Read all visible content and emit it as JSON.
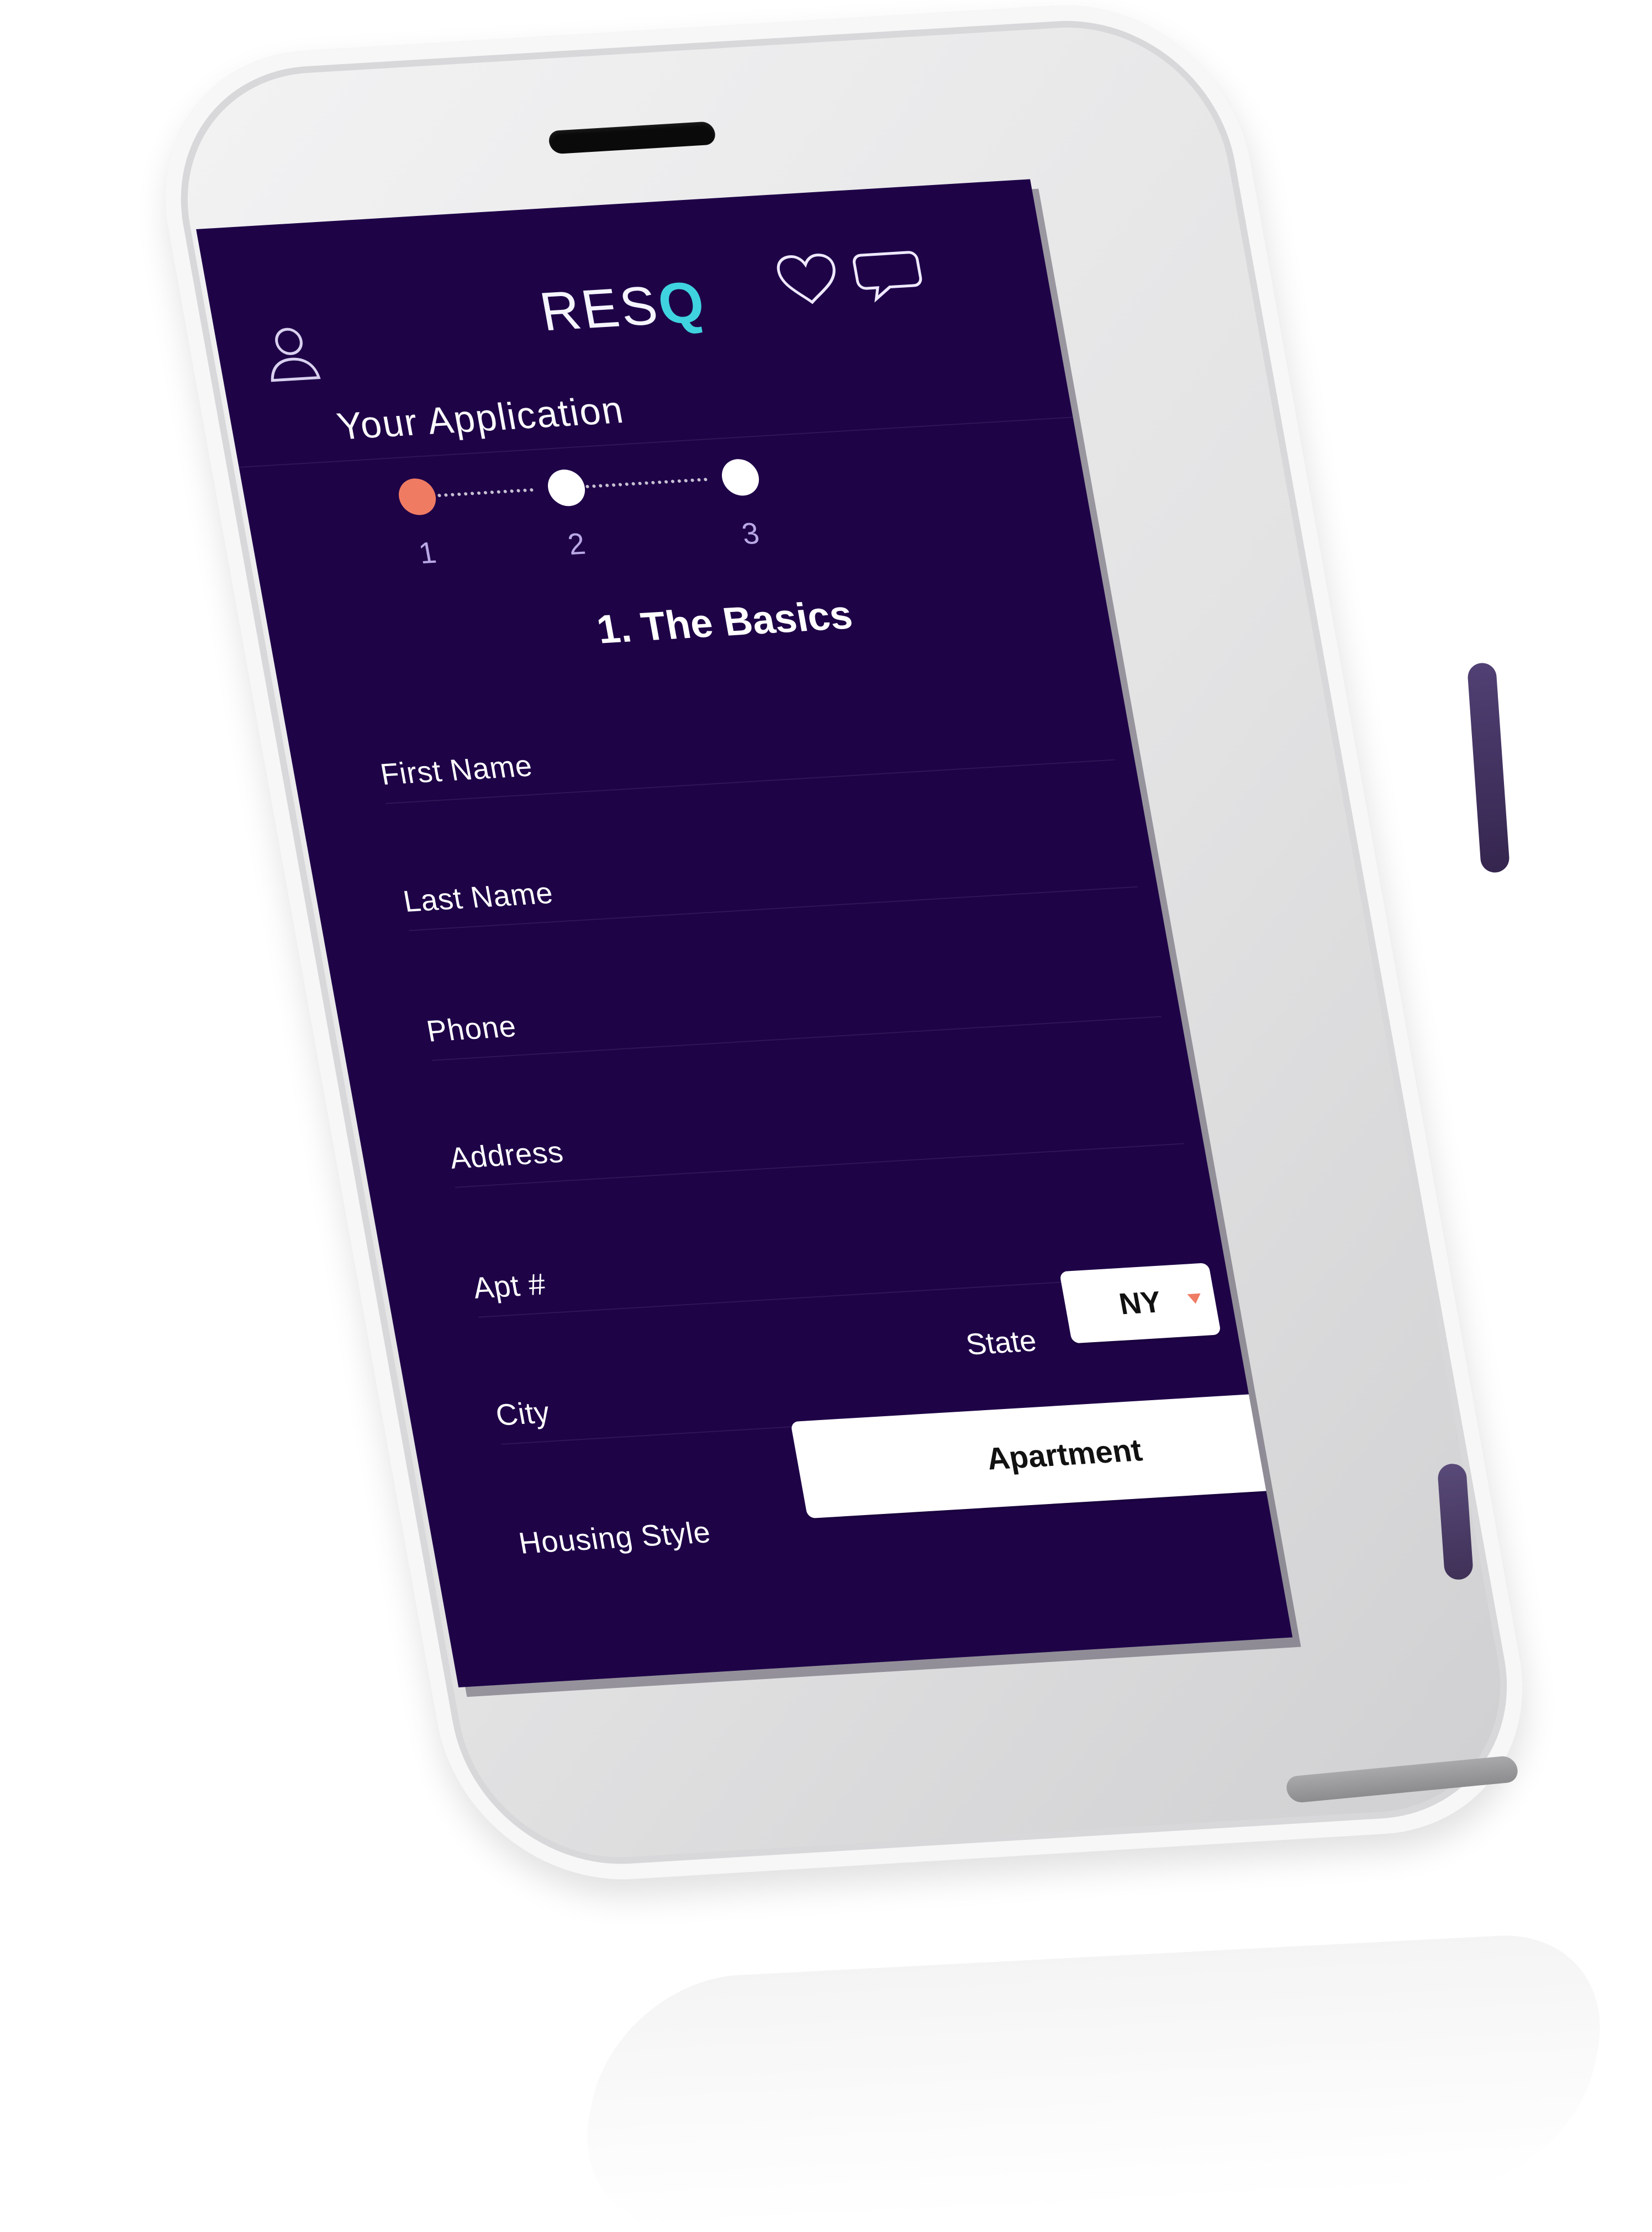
{
  "device": {
    "brand_logo": {
      "prefix": "RES",
      "accent": "Q"
    }
  },
  "topbar": {
    "user_icon": "user-icon",
    "heart_icon": "heart-icon",
    "chat_icon": "chat-icon"
  },
  "page": {
    "title": "Your Application",
    "section_title": "1. The Basics"
  },
  "steps": [
    {
      "number": "1",
      "status": "active"
    },
    {
      "number": "2",
      "status": "inactive"
    },
    {
      "number": "3",
      "status": "inactive"
    }
  ],
  "form": {
    "first_name_label": "First Name",
    "last_name_label": "Last Name",
    "phone_label": "Phone",
    "address_label": "Address",
    "apt_label": "Apt #",
    "city_label": "City",
    "state_label": "State",
    "state_value": "NY",
    "housing_label": "Housing Style",
    "housing_value": "Apartment"
  },
  "colors": {
    "screen_bg": "#1e0347",
    "logo_accent": "#3fd3df",
    "step_active": "#f07b63",
    "caret": "#f07b63"
  }
}
